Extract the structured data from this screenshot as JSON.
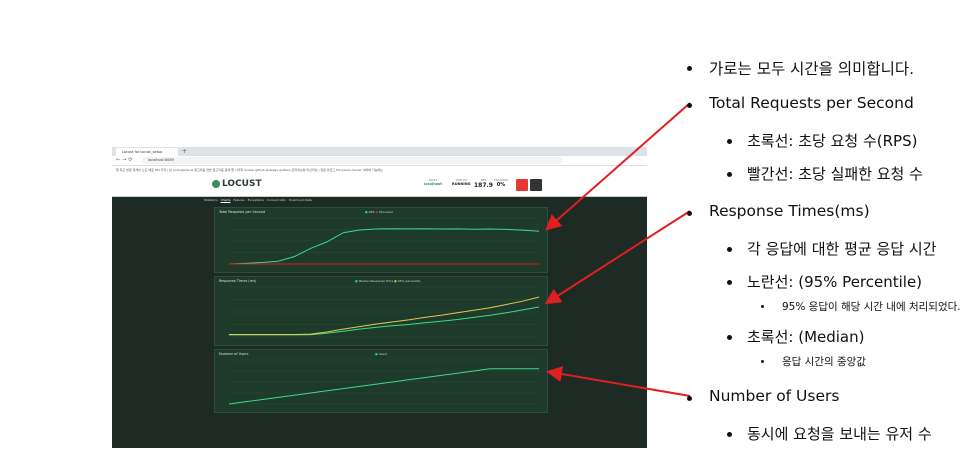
{
  "browser": {
    "tab_title": "Locust for locust_setup",
    "url": "localhost:8089",
    "bookmarks": "앱  최근 방문  릴레이 노트  배포 RPI 추적 | 빈  codingame  AI 알고리즘 연습  알고리즘 문제  앱 시각화  docker  github  strategy  grafana 트러블슈팅  머신러닝 | 입문 블로그  ML basics  docker  서버에 기능하는"
  },
  "locust": {
    "logo": "LOCUST",
    "host_label": "HOST",
    "host_value": "localhost",
    "status_label": "STATUS",
    "status_value": "RUNNING",
    "rps_label": "RPS",
    "rps_value": "187.9",
    "failures_label": "FAILURES",
    "failures_value": "0%",
    "tabs": [
      "Statistics",
      "Charts",
      "Failures",
      "Exceptions",
      "Current ratio",
      "Download Data"
    ]
  },
  "charts": [
    {
      "title": "Total Requests per Second",
      "legend": [
        "RPS",
        "Failures/s"
      ]
    },
    {
      "title": "Response Times (ms)",
      "legend": [
        "Median Response Time",
        "95% percentile"
      ]
    },
    {
      "title": "Number of Users",
      "legend": [
        "Users"
      ]
    }
  ],
  "colors": {
    "green_line": "#3ddc84",
    "yellow_line": "#e6c84a",
    "red_arrow": "#e02020",
    "panel_bg": "#1d3a2b"
  },
  "chart_data": [
    {
      "type": "line",
      "title": "Total Requests per Second",
      "series": [
        {
          "name": "RPS",
          "values": [
            0,
            3,
            8,
            15,
            40,
            85,
            120,
            170,
            185,
            190,
            192,
            191,
            192,
            190,
            191,
            189,
            190,
            188,
            184,
            178
          ]
        },
        {
          "name": "Failures/s",
          "values": [
            0,
            0,
            0,
            0,
            0,
            0,
            0,
            0,
            0,
            0,
            0,
            0,
            0,
            0,
            0,
            0,
            0,
            0,
            0,
            0
          ]
        }
      ],
      "ylim": [
        0,
        250
      ]
    },
    {
      "type": "line",
      "title": "Response Times (ms)",
      "series": [
        {
          "name": "Median Response Time",
          "values": [
            50,
            50,
            50,
            50,
            50,
            55,
            90,
            140,
            190,
            230,
            270,
            300,
            340,
            380,
            420,
            470,
            520,
            580,
            650,
            720
          ]
        },
        {
          "name": "95% percentile",
          "values": [
            60,
            60,
            60,
            60,
            60,
            70,
            120,
            190,
            250,
            310,
            360,
            410,
            470,
            520,
            580,
            640,
            700,
            780,
            860,
            960
          ]
        }
      ],
      "ylim": [
        0,
        1200
      ]
    },
    {
      "type": "line",
      "title": "Number of Users",
      "series": [
        {
          "name": "Users",
          "values": [
            0,
            25,
            50,
            75,
            100,
            125,
            150,
            175,
            200,
            225,
            250,
            275,
            300,
            325,
            350,
            375,
            400,
            400,
            400,
            400
          ]
        }
      ],
      "ylim": [
        0,
        500
      ]
    }
  ],
  "notes": {
    "l1": "가로는 모두 시간을 의미합니다.",
    "l2": "Total Requests per Second",
    "l3": "초록선: 초당 요청 수(RPS)",
    "l4": "빨간선: 초당 실패한 요청 수",
    "l5": "Response Times(ms)",
    "l6": "각 응답에 대한 평균 응답 시간",
    "l7": "노란선: (95% Percentile)",
    "l8": "95% 응답이 해당 시간 내에 처리되었다.",
    "l9": "초록선: (Median)",
    "l10": "응답 시간의 중앙값",
    "l11": "Number of Users",
    "l12": "동시에 요청을 보내는 유저 수"
  }
}
